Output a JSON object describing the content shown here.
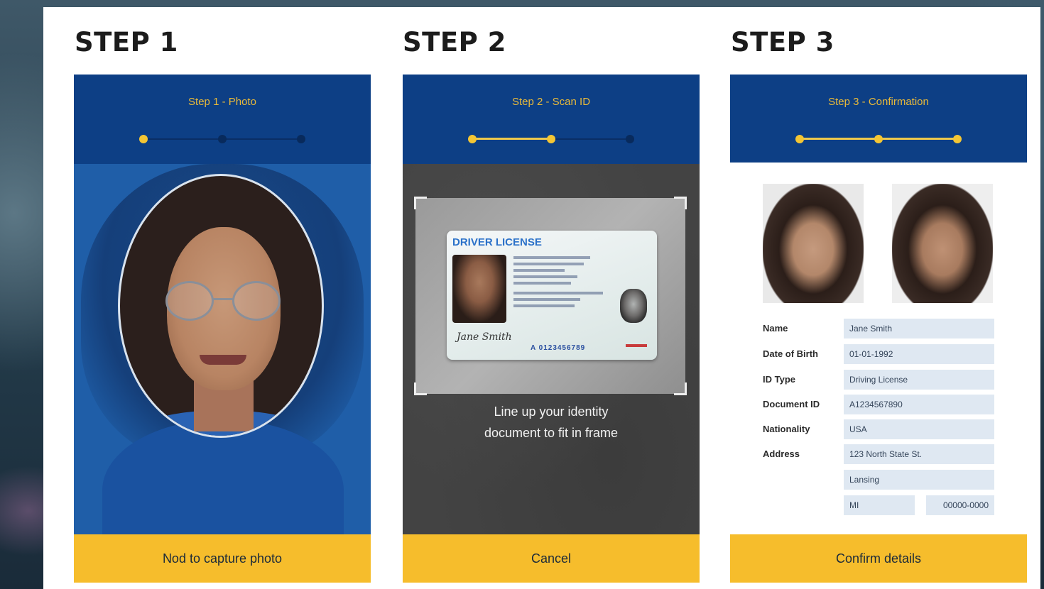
{
  "steps": [
    {
      "heading": "STEP 1",
      "screen_title": "Step 1 - Photo",
      "progress_completed": 1,
      "footer_button": "Nod to capture photo"
    },
    {
      "heading": "STEP 2",
      "screen_title": "Step 2 - Scan ID",
      "progress_completed": 2,
      "instruction": "Line up your identity document to fit in frame",
      "id_card": {
        "title": "DRIVER LICENSE",
        "signature": "Jane Smith",
        "number": "A 0123456789"
      },
      "footer_button": "Cancel"
    },
    {
      "heading": "STEP 3",
      "screen_title": "Step 3 - Confirmation",
      "progress_completed": 3,
      "fields": {
        "name_label": "Name",
        "name_value": "Jane Smith",
        "dob_label": "Date of Birth",
        "dob_value": "01-01-1992",
        "idtype_label": "ID Type",
        "idtype_value": "Driving License",
        "docid_label": "Document ID",
        "docid_value": "A1234567890",
        "nationality_label": "Nationality",
        "nationality_value": "USA",
        "address_label": "Address",
        "address_line1": "123 North State St.",
        "address_city": "Lansing",
        "address_state": "MI",
        "address_zip": "00000-0000"
      },
      "footer_button": "Confirm details"
    }
  ],
  "colors": {
    "header_blue": "#0d3f85",
    "accent_yellow": "#f6bd2c",
    "progress_yellow": "#f4c634"
  }
}
